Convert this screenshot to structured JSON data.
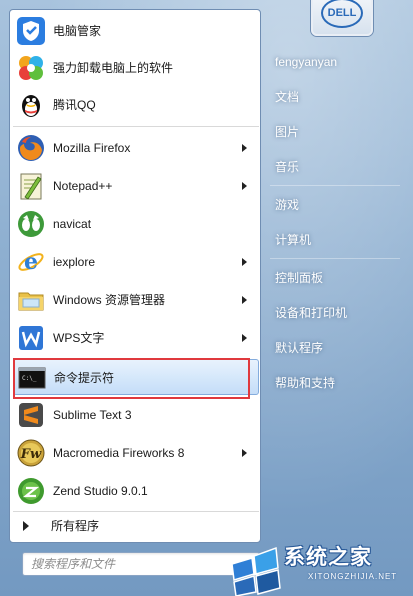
{
  "programs": [
    {
      "label": "电脑管家",
      "icon": "shield-icon",
      "arrow": false
    },
    {
      "label": "强力卸载电脑上的软件",
      "icon": "uninstall-icon",
      "arrow": false
    },
    {
      "label": "腾讯QQ",
      "icon": "penguin-icon",
      "arrow": false
    },
    {
      "label": "Mozilla Firefox",
      "icon": "firefox-icon",
      "arrow": true
    },
    {
      "label": "Notepad++",
      "icon": "notepad-icon",
      "arrow": true
    },
    {
      "label": "navicat",
      "icon": "navicat-icon",
      "arrow": false
    },
    {
      "label": "iexplore",
      "icon": "ie-icon",
      "arrow": true
    },
    {
      "label": "Windows 资源管理器",
      "icon": "folder-icon",
      "arrow": true
    },
    {
      "label": "WPS文字",
      "icon": "wps-icon",
      "arrow": true
    },
    {
      "label": "命令提示符",
      "icon": "cmd-icon",
      "arrow": false,
      "selected": true
    },
    {
      "label": "Sublime Text 3",
      "icon": "sublime-icon",
      "arrow": false
    },
    {
      "label": "Macromedia Fireworks 8",
      "icon": "fireworks-icon",
      "arrow": true
    },
    {
      "label": "Zend Studio 9.0.1",
      "icon": "zend-icon",
      "arrow": false
    }
  ],
  "all_programs_label": "所有程序",
  "search": {
    "placeholder": "搜索程序和文件"
  },
  "user": {
    "name": "fengyanyan",
    "tile_logo": "DELL"
  },
  "right_menu": [
    "文档",
    "图片",
    "音乐",
    "游戏",
    "计算机",
    "控制面板",
    "设备和打印机",
    "默认程序",
    "帮助和支持"
  ],
  "watermark": {
    "title": "系统之家",
    "url": "XITONGZHIJIA.NET"
  },
  "colors": {
    "highlight_box": "#e0393e",
    "selected_bg": "#d6e8fb"
  }
}
